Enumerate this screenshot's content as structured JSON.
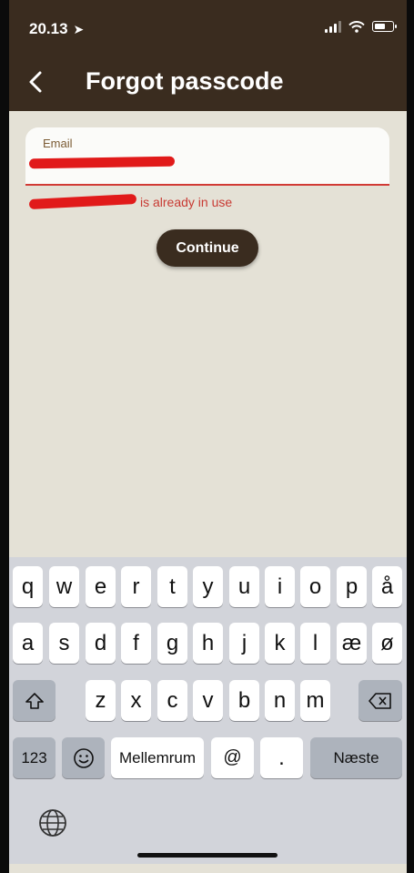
{
  "status_bar": {
    "time": "20.13"
  },
  "header": {
    "title": "Forgot passcode"
  },
  "email": {
    "label": "Email",
    "value": "",
    "error": "is already in use"
  },
  "continue_label": "Continue",
  "keyboard": {
    "row1": [
      "q",
      "w",
      "e",
      "r",
      "t",
      "y",
      "u",
      "i",
      "o",
      "p",
      "å"
    ],
    "row2": [
      "a",
      "s",
      "d",
      "f",
      "g",
      "h",
      "j",
      "k",
      "l",
      "æ",
      "ø"
    ],
    "row3": [
      "z",
      "x",
      "c",
      "v",
      "b",
      "n",
      "m"
    ],
    "numbers_label": "123",
    "space_label": "Mellemrum",
    "at_label": "@",
    "dot_label": ".",
    "next_label": "Næste"
  },
  "colors": {
    "header": "#3a2c1f",
    "background": "#e4e1d6",
    "error": "#d13a35",
    "label": "#7b5b34"
  }
}
